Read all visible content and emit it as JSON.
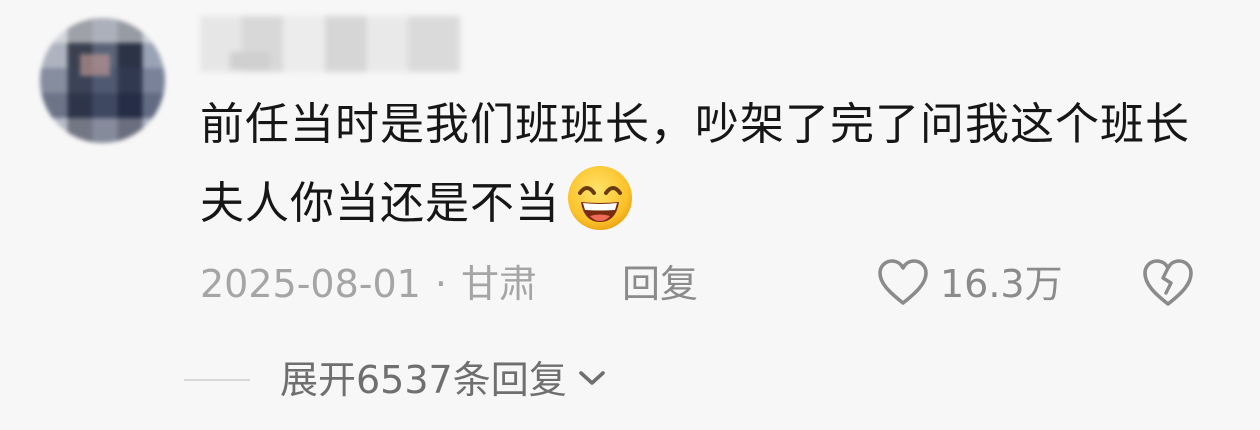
{
  "comment": {
    "text": "前任当时是我们班班长，吵架了完了问我这个班长夫人你当还是不当",
    "emoji": "grin-icon",
    "date": "2025-08-01",
    "separator": "·",
    "location": "甘肃",
    "reply_label": "回复",
    "like_count": "16.3万",
    "like_icon": "heart-outline-icon",
    "dislike_icon": "broken-heart-icon"
  },
  "expand": {
    "label": "展开6537条回复",
    "icon": "chevron-down-icon"
  },
  "colors": {
    "text": "#161616",
    "meta": "#a5a5a5",
    "action": "#8b8b8b",
    "background": "#f7f7f7"
  }
}
